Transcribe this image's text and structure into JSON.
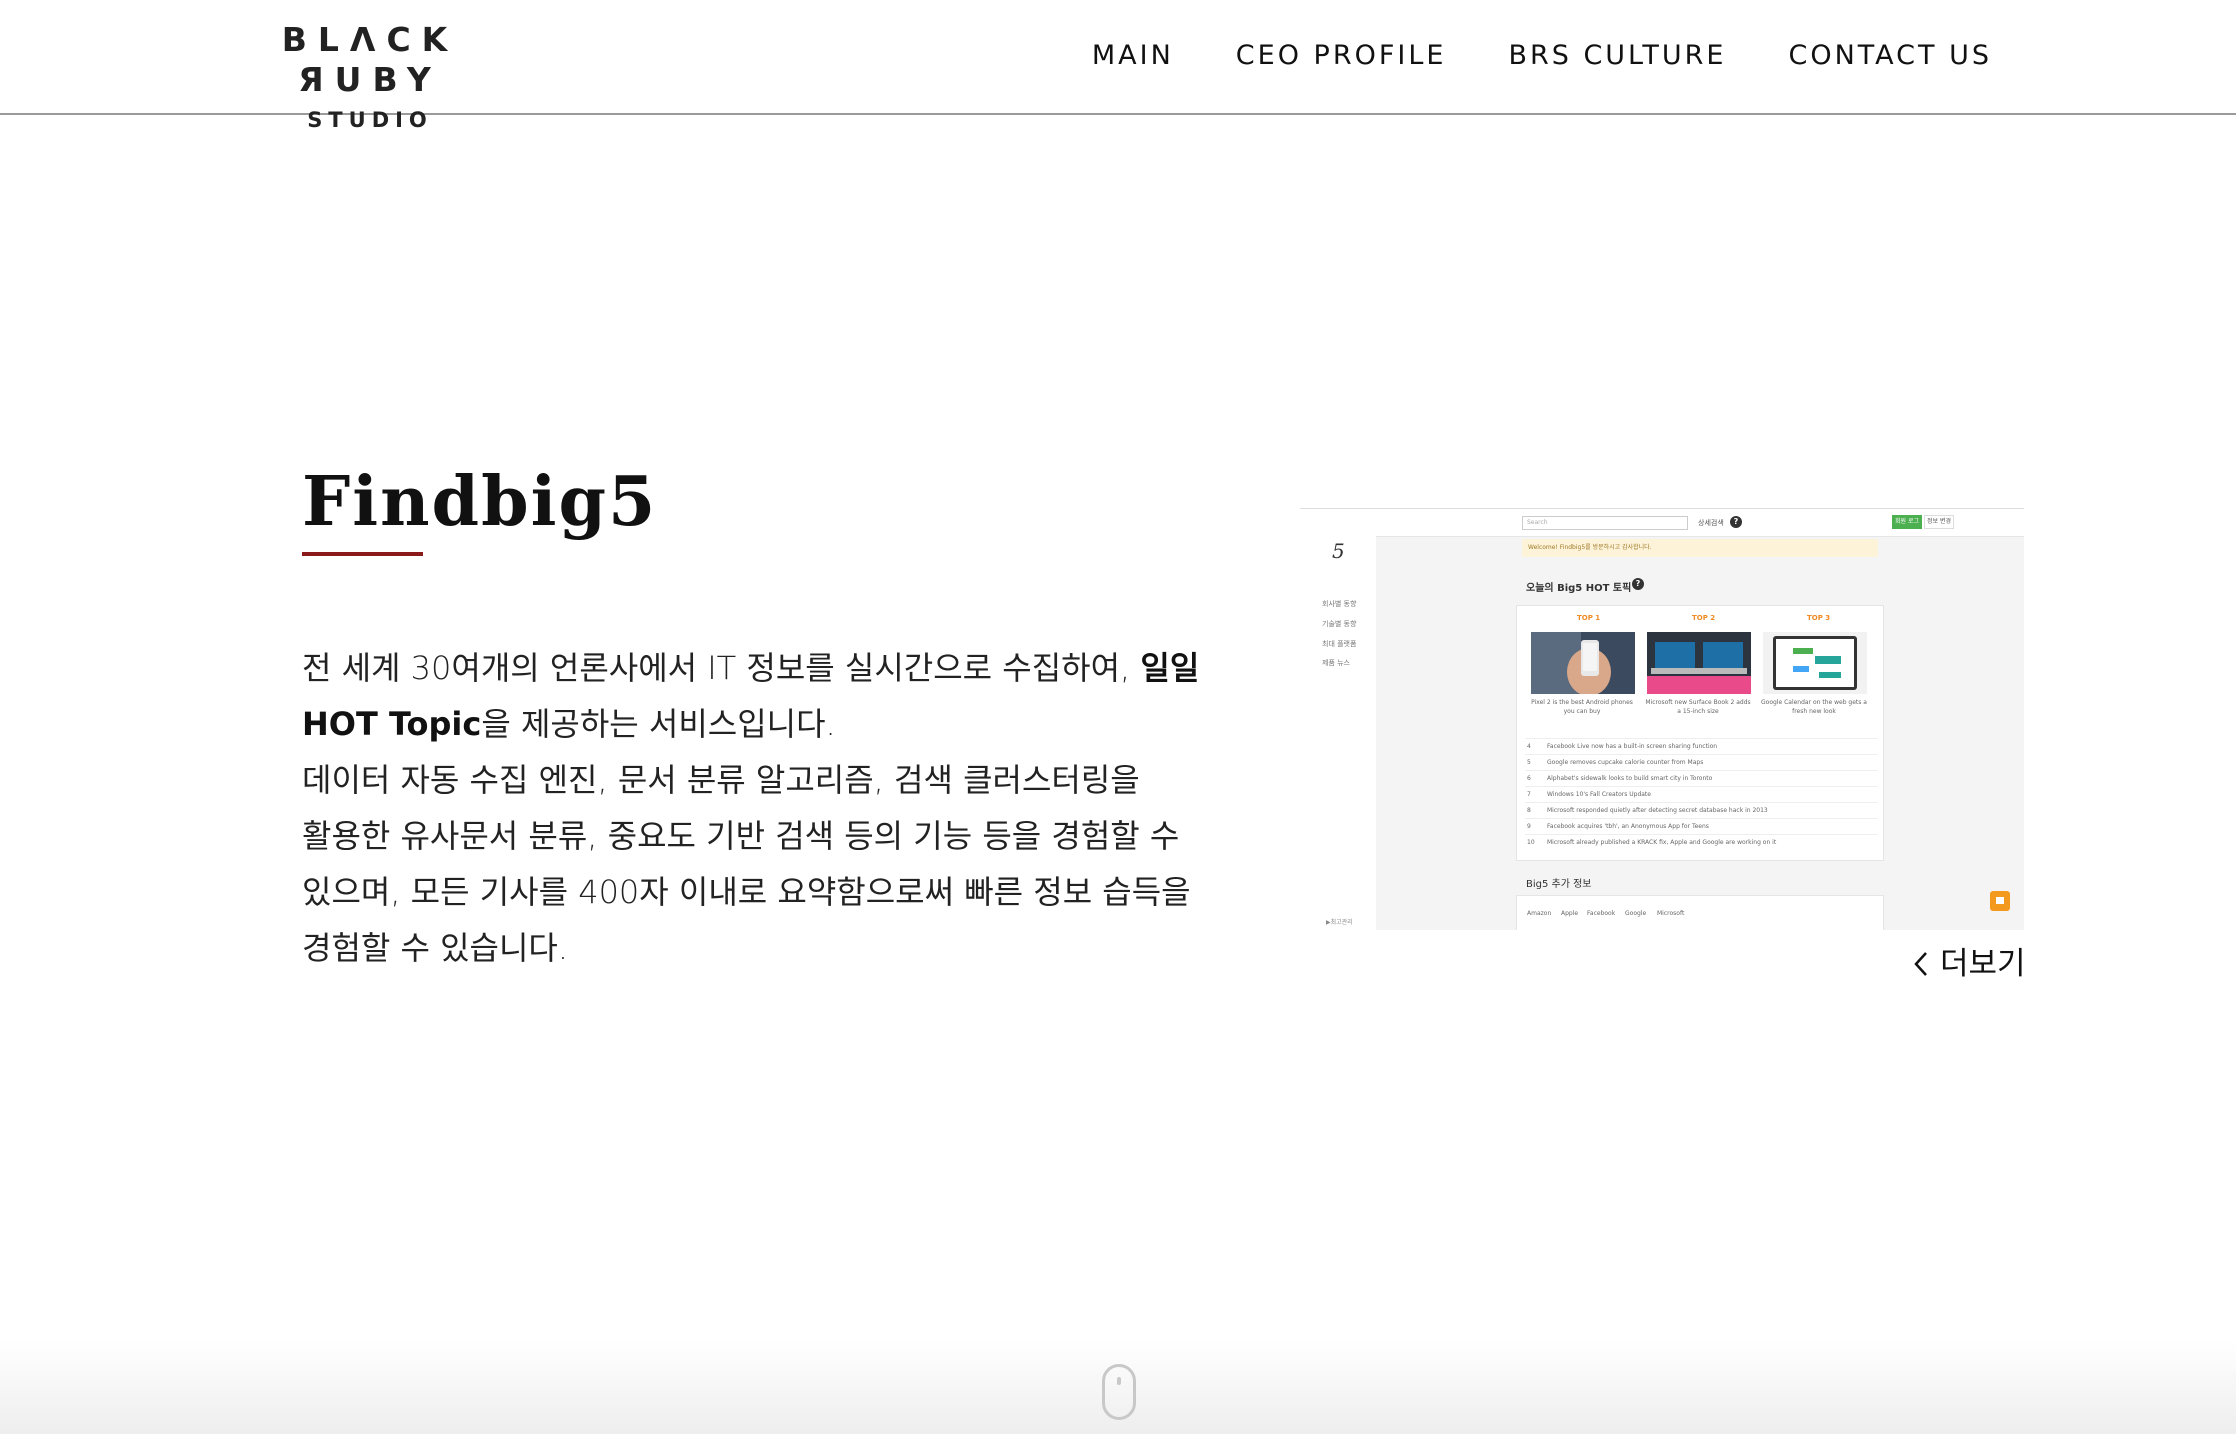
{
  "header": {
    "logo_main": "BLΛCK ЯUBY",
    "logo_sub": "STUDIO",
    "nav": [
      "MAIN",
      "CEO PROFILE",
      "BRS CULTURE",
      "CONTACT US"
    ]
  },
  "section": {
    "title": "Findbig5",
    "desc_part1": "전 세계 30여개의 언론사에서 IT 정보를 실시간으로 수집하여, ",
    "desc_bold": "일일 HOT Topic",
    "desc_part2": "을 제공하는 서비스입니다.",
    "desc_part3": "데이터 자동 수집 엔진, 문서 분류 알고리즘, 검색 클러스터링을 활용한 유사문서 분류, 중요도 기반 검색 등의 기능 등을 경험할 수 있으며, 모든 기사를 400자 이내로 요약함으로써 빠른 정보 습득을 경험할 수 있습니다.",
    "more_label": "더보기"
  },
  "screenshot": {
    "logo": "5",
    "side_items": [
      "회사별 동향",
      "기술별 동향",
      "최대 플랫폼",
      "제품 뉴스"
    ],
    "search_placeholder": "Search",
    "top_link": "상세검색",
    "help": "?",
    "btn_green": "회원 로그",
    "btn_white": "정보 변경",
    "notice": "Welcome! Findbig5를 방문하시고 감사합니다.",
    "hot_title": "오늘의 Big5 HOT 토픽",
    "top_labels": [
      "TOP 1",
      "TOP 2",
      "TOP 3"
    ],
    "captions": [
      "Pixel 2 is the best Android phones you can buy",
      "Microsoft new Surface Book 2 adds a 15-inch size",
      "Google Calendar on the web gets a fresh new look"
    ],
    "rows": [
      {
        "n": "4",
        "t": "Facebook Live now has a built-in screen sharing function"
      },
      {
        "n": "5",
        "t": "Google removes cupcake calorie counter from Maps"
      },
      {
        "n": "6",
        "t": "Alphabet's sidewalk looks to build smart city in Toronto"
      },
      {
        "n": "7",
        "t": "Windows 10's Fall Creators Update"
      },
      {
        "n": "8",
        "t": "Microsoft responded quietly after detecting secret database hack in 2013"
      },
      {
        "n": "9",
        "t": "Facebook acquires 'tbh', an Anonymous App for Teens"
      },
      {
        "n": "10",
        "t": "Microsoft already published a KRACK fix, Apple and Google are working on it"
      }
    ],
    "more_title": "Big5 추가 정보",
    "tags": [
      "Amazon",
      "Apple",
      "Facebook",
      "Google",
      "Microsoft"
    ],
    "footer_left": "▶최고관리"
  }
}
